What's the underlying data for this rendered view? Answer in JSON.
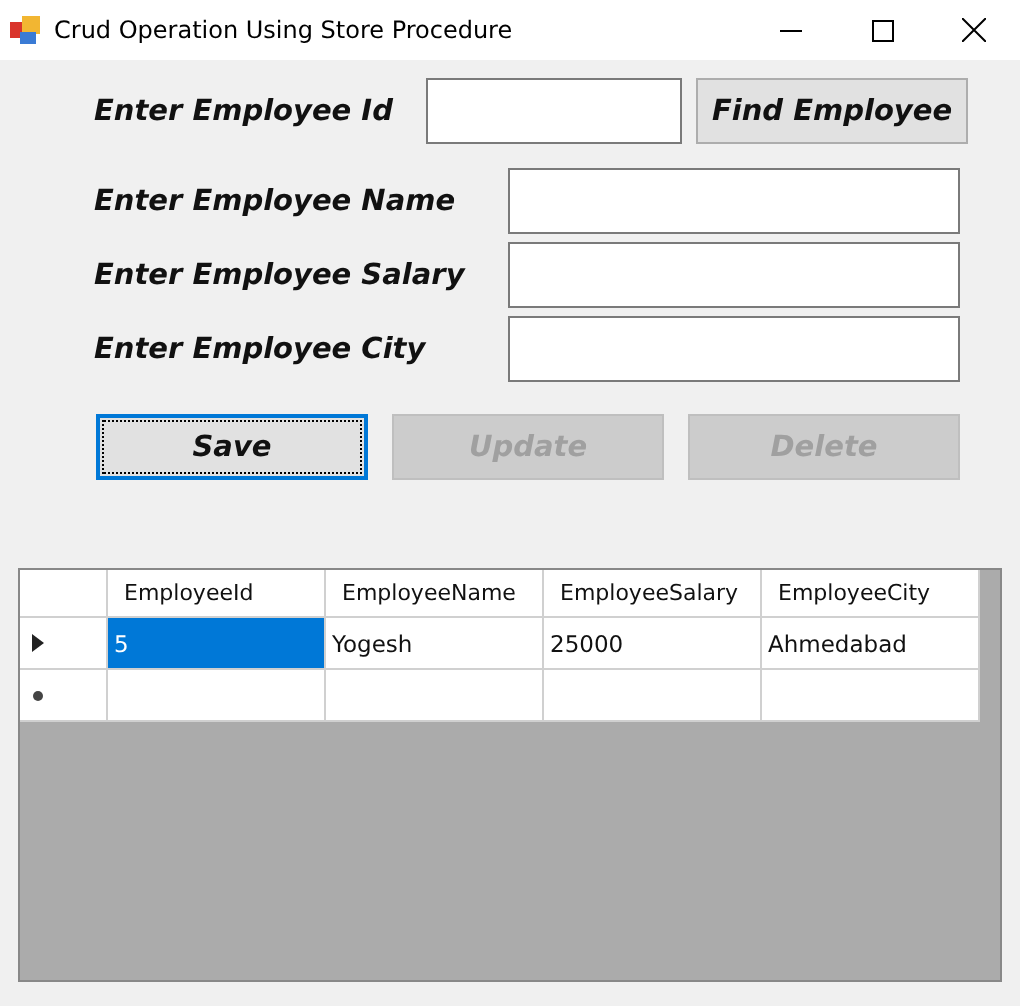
{
  "window": {
    "title": "Crud Operation Using Store Procedure"
  },
  "lookup": {
    "label": "Enter Employee Id",
    "button": "Find Employee"
  },
  "fields": [
    {
      "label": "Enter Employee Name"
    },
    {
      "label": "Enter Employee Salary"
    },
    {
      "label": "Enter Employee City"
    }
  ],
  "buttons": [
    {
      "label": "Save",
      "disabled": false,
      "focused": true
    },
    {
      "label": "Update",
      "disabled": true,
      "focused": false
    },
    {
      "label": "Delete",
      "disabled": true,
      "focused": false
    }
  ],
  "grid": {
    "columns": [
      "EmployeeId",
      "EmployeeName",
      "EmployeeSalary",
      "EmployeeCity"
    ],
    "rows": [
      {
        "kind": "current",
        "cells": [
          {
            "text": "5",
            "selected": true
          },
          {
            "text": "Yogesh",
            "selected": false
          },
          {
            "text": "25000",
            "selected": false
          },
          {
            "text": "Ahmedabad",
            "selected": false
          }
        ]
      },
      {
        "kind": "new"
      }
    ]
  }
}
